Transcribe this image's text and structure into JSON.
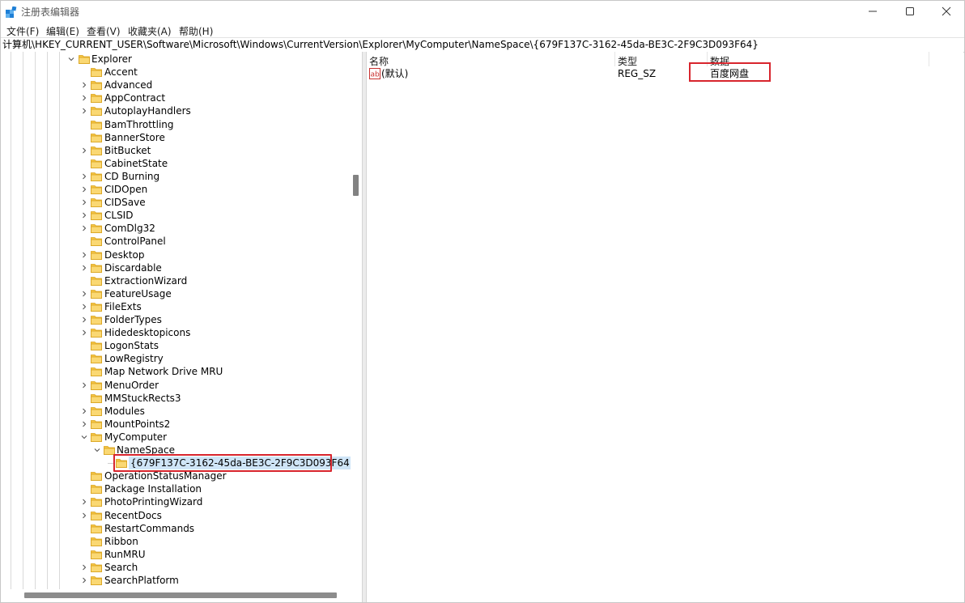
{
  "window": {
    "title": "注册表编辑器",
    "controls": [
      "minimize",
      "maximize",
      "close"
    ]
  },
  "menu": [
    "文件(F)",
    "编辑(E)",
    "查看(V)",
    "收藏夹(A)",
    "帮助(H)"
  ],
  "address": "计算机\\HKEY_CURRENT_USER\\Software\\Microsoft\\Windows\\CurrentVersion\\Explorer\\MyComputer\\NameSpace\\{679F137C-3162-45da-BE3C-2F9C3D093F64}",
  "tree": [
    {
      "label": "Explorer",
      "depth": 0,
      "expander": "expanded"
    },
    {
      "label": "Accent",
      "depth": 1,
      "expander": "none"
    },
    {
      "label": "Advanced",
      "depth": 1,
      "expander": "collapsed"
    },
    {
      "label": "AppContract",
      "depth": 1,
      "expander": "collapsed"
    },
    {
      "label": "AutoplayHandlers",
      "depth": 1,
      "expander": "collapsed"
    },
    {
      "label": "BamThrottling",
      "depth": 1,
      "expander": "none"
    },
    {
      "label": "BannerStore",
      "depth": 1,
      "expander": "none"
    },
    {
      "label": "BitBucket",
      "depth": 1,
      "expander": "collapsed"
    },
    {
      "label": "CabinetState",
      "depth": 1,
      "expander": "none"
    },
    {
      "label": "CD Burning",
      "depth": 1,
      "expander": "collapsed"
    },
    {
      "label": "CIDOpen",
      "depth": 1,
      "expander": "collapsed"
    },
    {
      "label": "CIDSave",
      "depth": 1,
      "expander": "collapsed"
    },
    {
      "label": "CLSID",
      "depth": 1,
      "expander": "collapsed"
    },
    {
      "label": "ComDlg32",
      "depth": 1,
      "expander": "collapsed"
    },
    {
      "label": "ControlPanel",
      "depth": 1,
      "expander": "none"
    },
    {
      "label": "Desktop",
      "depth": 1,
      "expander": "collapsed"
    },
    {
      "label": "Discardable",
      "depth": 1,
      "expander": "collapsed"
    },
    {
      "label": "ExtractionWizard",
      "depth": 1,
      "expander": "none"
    },
    {
      "label": "FeatureUsage",
      "depth": 1,
      "expander": "collapsed"
    },
    {
      "label": "FileExts",
      "depth": 1,
      "expander": "collapsed"
    },
    {
      "label": "FolderTypes",
      "depth": 1,
      "expander": "collapsed"
    },
    {
      "label": "Hidedesktopicons",
      "depth": 1,
      "expander": "collapsed"
    },
    {
      "label": "LogonStats",
      "depth": 1,
      "expander": "none"
    },
    {
      "label": "LowRegistry",
      "depth": 1,
      "expander": "none"
    },
    {
      "label": "Map Network Drive MRU",
      "depth": 1,
      "expander": "none"
    },
    {
      "label": "MenuOrder",
      "depth": 1,
      "expander": "collapsed"
    },
    {
      "label": "MMStuckRects3",
      "depth": 1,
      "expander": "none"
    },
    {
      "label": "Modules",
      "depth": 1,
      "expander": "collapsed"
    },
    {
      "label": "MountPoints2",
      "depth": 1,
      "expander": "collapsed"
    },
    {
      "label": "MyComputer",
      "depth": 1,
      "expander": "expanded"
    },
    {
      "label": "NameSpace",
      "depth": 2,
      "expander": "expanded"
    },
    {
      "label": "{679F137C-3162-45da-BE3C-2F9C3D093F64}",
      "depth": 3,
      "expander": "none",
      "selected": true
    },
    {
      "label": "OperationStatusManager",
      "depth": 1,
      "expander": "none"
    },
    {
      "label": "Package Installation",
      "depth": 1,
      "expander": "none"
    },
    {
      "label": "PhotoPrintingWizard",
      "depth": 1,
      "expander": "collapsed"
    },
    {
      "label": "RecentDocs",
      "depth": 1,
      "expander": "collapsed"
    },
    {
      "label": "RestartCommands",
      "depth": 1,
      "expander": "none"
    },
    {
      "label": "Ribbon",
      "depth": 1,
      "expander": "none"
    },
    {
      "label": "RunMRU",
      "depth": 1,
      "expander": "none"
    },
    {
      "label": "Search",
      "depth": 1,
      "expander": "collapsed"
    },
    {
      "label": "SearchPlatform",
      "depth": 1,
      "expander": "collapsed"
    }
  ],
  "list": {
    "headers": {
      "name": "名称",
      "type": "类型",
      "data": "数据"
    },
    "rows": [
      {
        "name": "(默认)",
        "type": "REG_SZ",
        "data": "百度网盘",
        "icon": "string-value-icon"
      }
    ]
  },
  "colors": {
    "highlight": "#d8252d",
    "folder": "#f6c544",
    "selection": "#cfe5f7",
    "app_icon": "#1e7fd6"
  }
}
